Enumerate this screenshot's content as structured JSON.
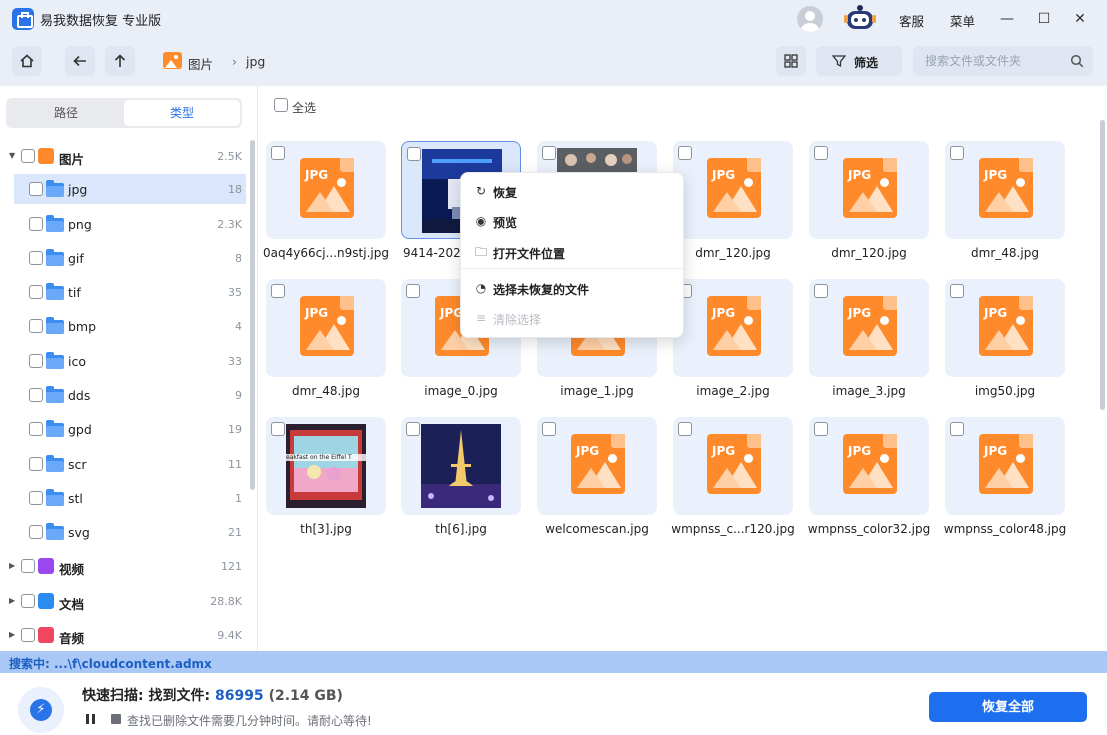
{
  "app": {
    "title": "易我数据恢复 专业版"
  },
  "titlebar": {
    "service": "客服",
    "menu": "菜单"
  },
  "toolbar": {
    "breadcrumb": [
      "图片",
      "jpg"
    ],
    "filter_label": "筛选",
    "search_placeholder": "搜索文件或文件夹"
  },
  "sidebar": {
    "tabs": [
      "路径",
      "类型"
    ],
    "active_tab": "类型",
    "categories": [
      {
        "label": "图片",
        "count": "2.5K",
        "icon": "image-icon",
        "color": "#ff8a2b",
        "expanded": true
      },
      {
        "label": "视频",
        "count": "121",
        "icon": "video-icon",
        "color": "#9b47f0"
      },
      {
        "label": "文档",
        "count": "28.8K",
        "icon": "document-icon",
        "color": "#2b8bf0"
      },
      {
        "label": "音频",
        "count": "9.4K",
        "icon": "audio-icon",
        "color": "#f0475f"
      }
    ],
    "subfolders": [
      {
        "label": "jpg",
        "count": "18",
        "selected": true
      },
      {
        "label": "png",
        "count": "2.3K"
      },
      {
        "label": "gif",
        "count": "8"
      },
      {
        "label": "tif",
        "count": "35"
      },
      {
        "label": "bmp",
        "count": "4"
      },
      {
        "label": "ico",
        "count": "33"
      },
      {
        "label": "dds",
        "count": "9"
      },
      {
        "label": "gpd",
        "count": "19"
      },
      {
        "label": "scr",
        "count": "11"
      },
      {
        "label": "stl",
        "count": "1"
      },
      {
        "label": "svg",
        "count": "21"
      }
    ]
  },
  "main": {
    "select_all": "全选",
    "files": [
      {
        "name": "0aq4y66cj...n9stj.jpg",
        "thumb": "jpg-icon"
      },
      {
        "name": "9414-202",
        "thumb": "photo-stage",
        "highlight": true
      },
      {
        "name": "",
        "thumb": "photo-crowd"
      },
      {
        "name": "dmr_120.jpg",
        "thumb": "jpg-icon"
      },
      {
        "name": "dmr_120.jpg",
        "thumb": "jpg-icon"
      },
      {
        "name": "dmr_48.jpg",
        "thumb": "jpg-icon"
      },
      {
        "name": "dmr_48.jpg",
        "thumb": "jpg-icon"
      },
      {
        "name": "image_0.jpg",
        "thumb": "jpg-icon"
      },
      {
        "name": "image_1.jpg",
        "thumb": "jpg-icon"
      },
      {
        "name": "image_2.jpg",
        "thumb": "jpg-icon"
      },
      {
        "name": "image_3.jpg",
        "thumb": "jpg-icon"
      },
      {
        "name": "img50.jpg",
        "thumb": "jpg-icon"
      },
      {
        "name": "th[3].jpg",
        "thumb": "photo-cartoon"
      },
      {
        "name": "th[6].jpg",
        "thumb": "photo-eiffel"
      },
      {
        "name": "welcomescan.jpg",
        "thumb": "jpg-icon"
      },
      {
        "name": "wmpnss_c...r120.jpg",
        "thumb": "jpg-icon"
      },
      {
        "name": "wmpnss_color32.jpg",
        "thumb": "jpg-icon"
      },
      {
        "name": "wmpnss_color48.jpg",
        "thumb": "jpg-icon"
      }
    ],
    "jpg_tag": "JPG",
    "cartoon_caption": "eakfast on the Eiffel T"
  },
  "context_menu": {
    "items": [
      {
        "label": "恢复",
        "icon": "restore-icon"
      },
      {
        "label": "预览",
        "icon": "eye-icon"
      },
      {
        "label": "打开文件位置",
        "icon": "folder-open-icon"
      },
      {
        "label": "选择未恢复的文件",
        "icon": "select-unrecovered-icon"
      },
      {
        "label": "清除选择",
        "icon": "clear-selection-icon",
        "disabled": true
      }
    ]
  },
  "status": {
    "searching": "搜索中:   ...\\f\\cloudcontent.admx"
  },
  "bottom": {
    "scan_label": "快速扫描:",
    "found_label": "找到文件:",
    "count": "86995",
    "size": "(2.14 GB)",
    "hint": "查找已删除文件需要几分钟时间。请耐心等待!",
    "recover_all": "恢复全部"
  },
  "colors": {
    "accent": "#1e6ff0",
    "jpg": "#ff8a2b",
    "folder": "#3d8cf2",
    "status_bar": "#a9c8f5"
  }
}
